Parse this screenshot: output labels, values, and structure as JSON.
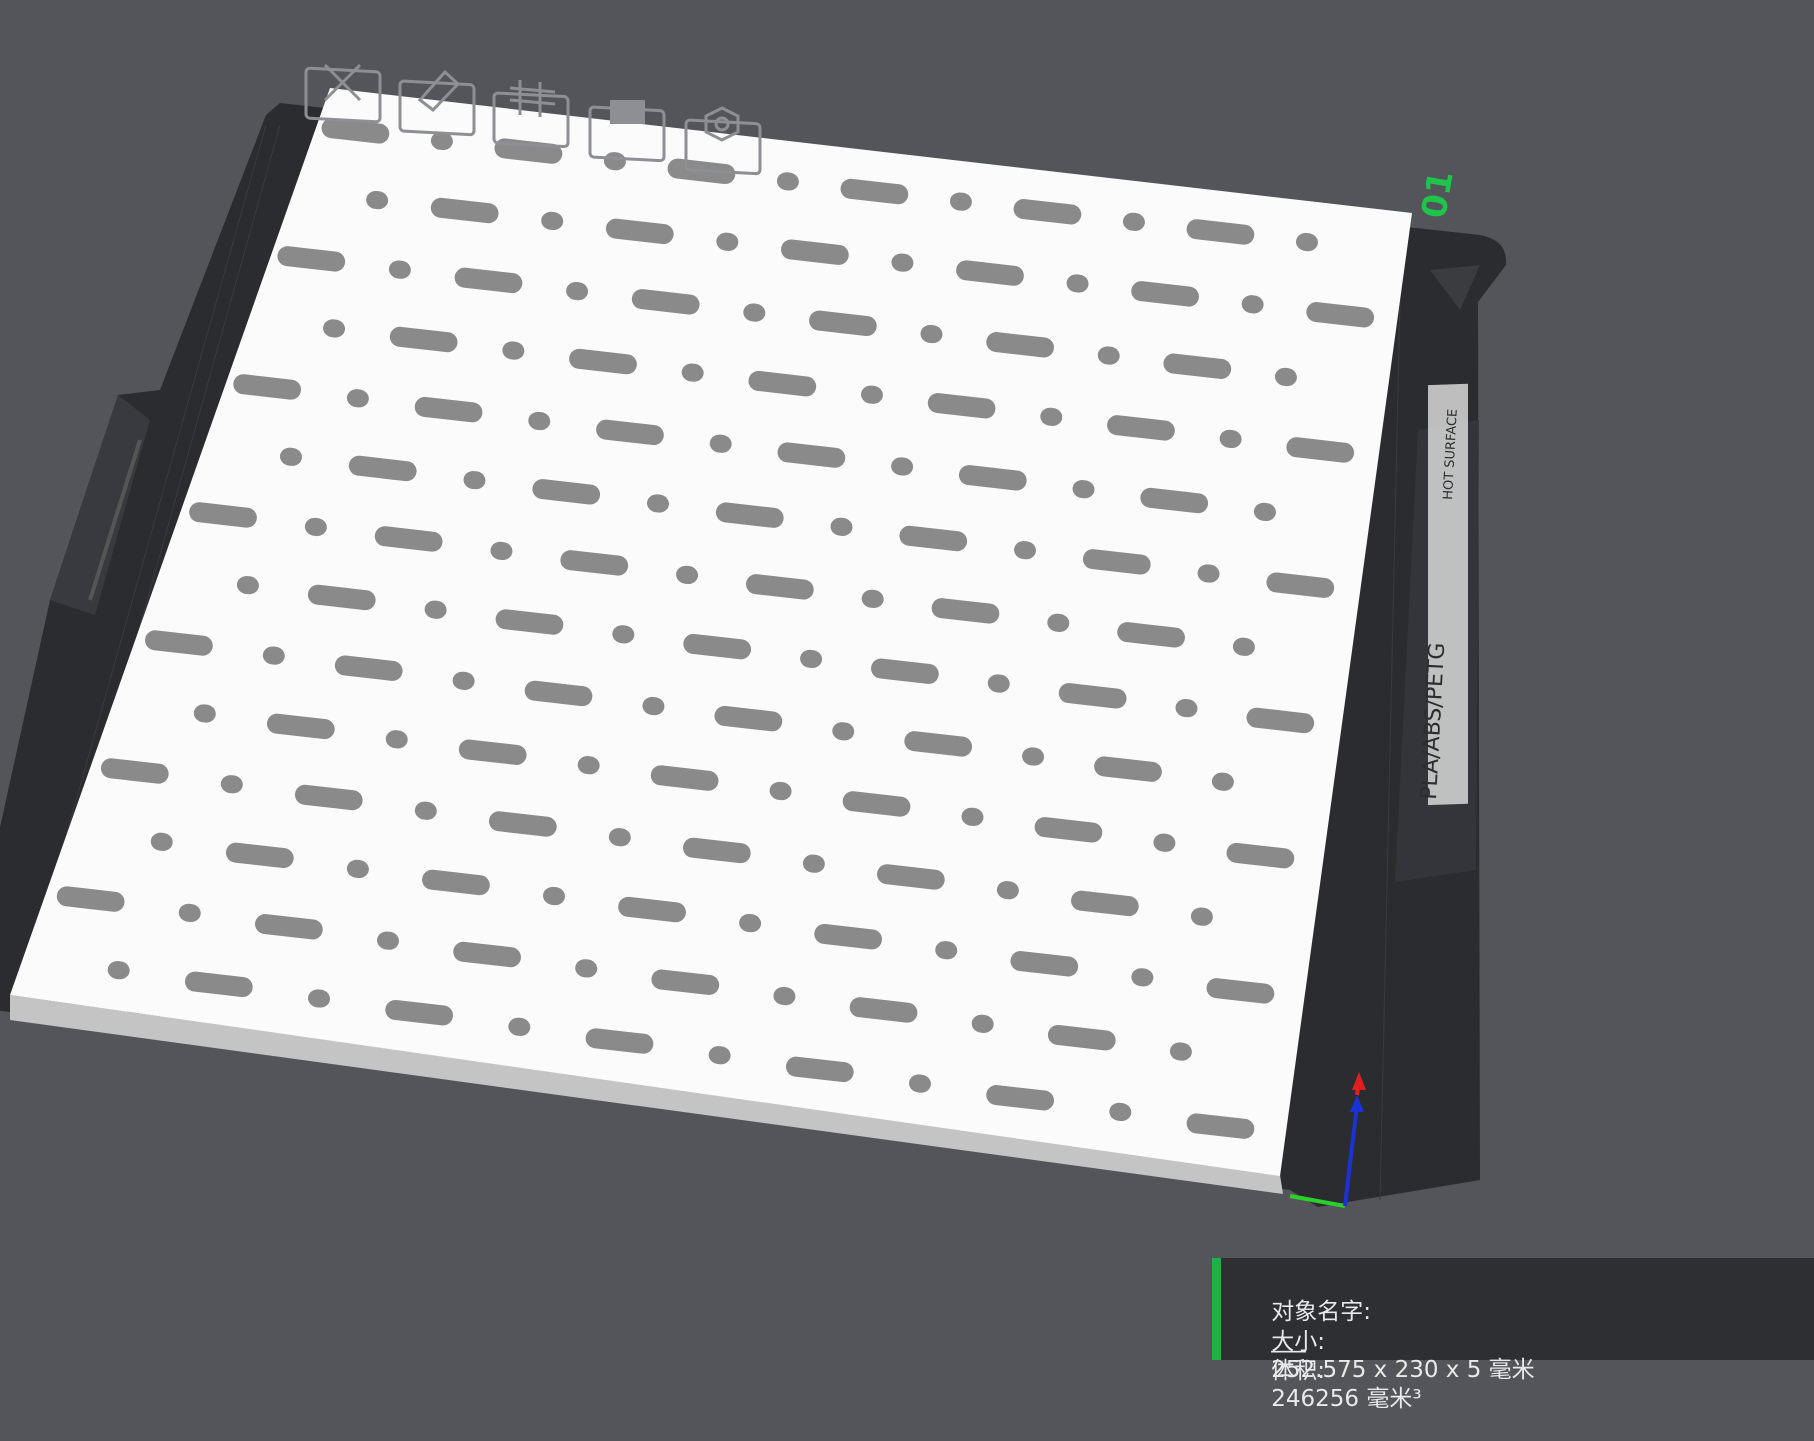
{
  "plate": {
    "index_label": "01",
    "material_label": "PLA/ABS/PETG",
    "warning_label": "HOT SURFACE",
    "colors": {
      "background": "#53555a",
      "bed": "#2c2d31",
      "model_top": "#ffffff",
      "model_side": "#c9c9c9",
      "hole": "#8a8a8a",
      "plate_index": "#1fc44b"
    }
  },
  "toolbar": {
    "icons": [
      "delete-icon",
      "edit-plate-icon",
      "arrange-icon",
      "lock-icon",
      "settings-icon"
    ]
  },
  "axes": {
    "x_color": "#2bd12b",
    "y_color": "#1b32d6",
    "z_color": "#e02020"
  },
  "object_info": {
    "name_label": "对象名字:",
    "name_value": "___",
    "size_label": "大小:",
    "size_value": "252.575 x 230 x 5 毫米",
    "volume_label": "体积:",
    "volume_value": "246256 毫米³",
    "accent_color": "#1fb04a"
  }
}
